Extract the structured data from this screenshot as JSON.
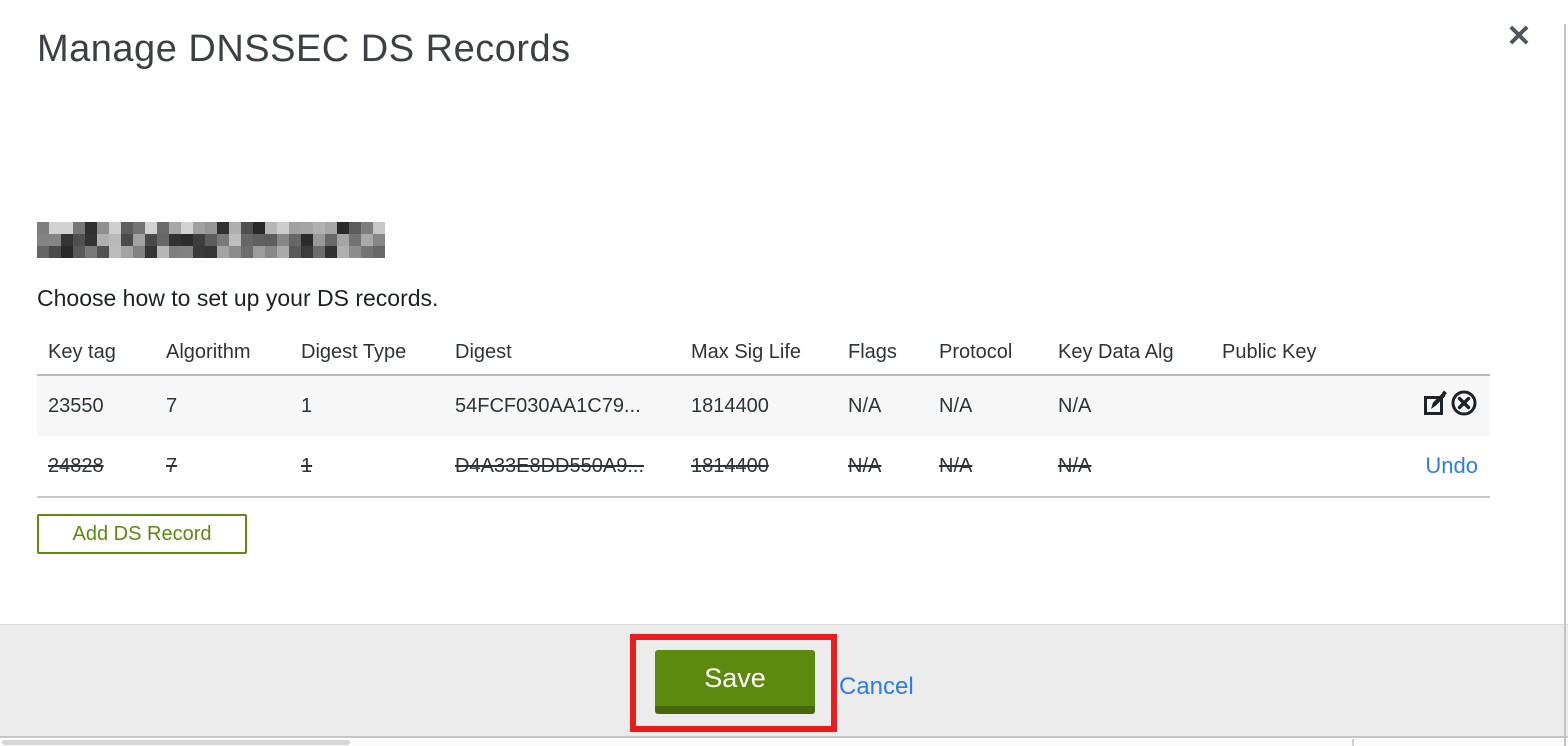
{
  "modal": {
    "title": "Manage DNSSEC DS Records",
    "instruction": "Choose how to set up your DS records.",
    "domain_redacted": true
  },
  "icons": {
    "close": "✕"
  },
  "table": {
    "headers": [
      "Key tag",
      "Algorithm",
      "Digest Type",
      "Digest",
      "Max Sig Life",
      "Flags",
      "Protocol",
      "Key Data Alg",
      "Public Key"
    ],
    "rows": [
      {
        "state": "active",
        "cells": [
          "23550",
          "7",
          "1",
          "54FCF030AA1C79...",
          "1814400",
          "N/A",
          "N/A",
          "N/A",
          ""
        ]
      },
      {
        "state": "deleted",
        "cells": [
          "24828",
          "7",
          "1",
          "D4A33E8DD550A9...",
          "1814400",
          "N/A",
          "N/A",
          "N/A",
          ""
        ],
        "undo_label": "Undo"
      }
    ]
  },
  "buttons": {
    "add_ds_record": "Add DS Record",
    "save": "Save",
    "cancel": "Cancel"
  },
  "colors": {
    "accent_green": "#5c8a0e",
    "accent_green_dark": "#47680a",
    "link_blue": "#2e7bee",
    "annotation_red": "#ed1c1c"
  }
}
